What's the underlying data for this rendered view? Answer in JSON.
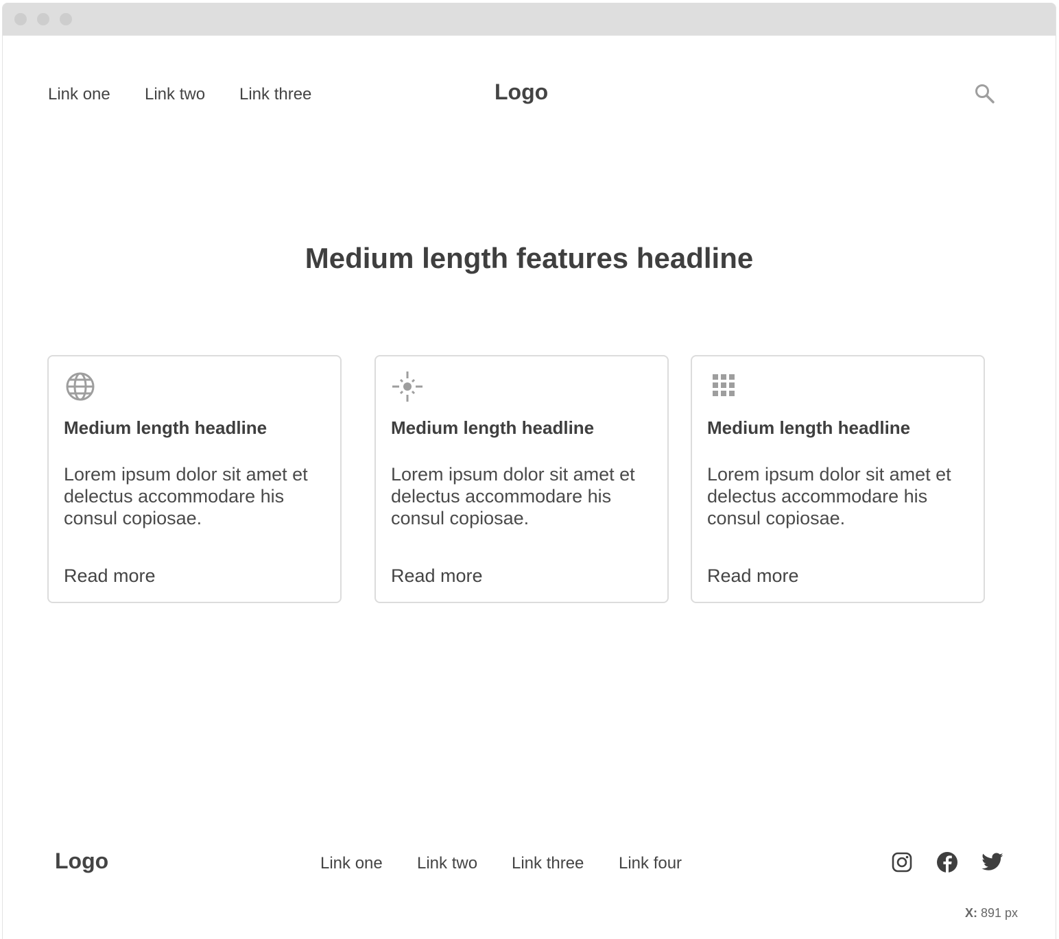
{
  "header": {
    "nav_links": [
      "Link one",
      "Link two",
      "Link three"
    ],
    "logo": "Logo",
    "search_icon": "search-icon"
  },
  "features": {
    "headline": "Medium length features headline",
    "cards": [
      {
        "icon": "globe-icon",
        "title": "Medium length headline",
        "body": "Lorem ipsum dolor sit amet et delectus accommodare his consul copiosae.",
        "link": "Read more"
      },
      {
        "icon": "sun-icon",
        "title": "Medium length headline",
        "body": "Lorem ipsum dolor sit amet et delectus accommodare his consul copiosae.",
        "link": "Read more"
      },
      {
        "icon": "grid-icon",
        "title": "Medium length headline",
        "body": "Lorem ipsum dolor sit amet et delectus accommodare his consul copiosae.",
        "link": "Read more"
      }
    ]
  },
  "footer": {
    "logo": "Logo",
    "links": [
      "Link one",
      "Link two",
      "Link three",
      "Link four"
    ],
    "social_icons": [
      "instagram-icon",
      "facebook-icon",
      "twitter-icon"
    ]
  },
  "coordinate_readout": {
    "label": "X:",
    "value": "891 px"
  },
  "colors": {
    "text": "#3f3f3f",
    "icon": "#9e9e9e",
    "border": "#dcdcdc",
    "titlebar": "#dedede"
  }
}
